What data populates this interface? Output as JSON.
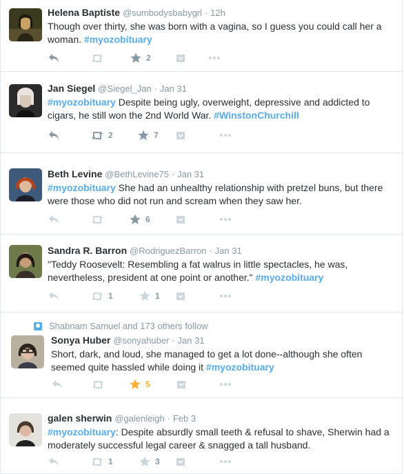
{
  "colors": {
    "link": "#55acee",
    "muted": "#8899a6",
    "fav_active": "#ffac33",
    "text": "#292f33"
  },
  "icons": [
    "reply-icon",
    "retweet-icon",
    "favorite-icon",
    "pocket-icon",
    "more-icon"
  ],
  "tweets": [
    {
      "name": "Helena Baptiste",
      "handle": "@sumbodysbabygrl",
      "time": "12h",
      "text_before": "Though over thirty, she was born with a vagina, so I guess you could call her a woman. ",
      "hashtag": "#myozobituary",
      "text_after": "",
      "retweets": "",
      "favorites": "2"
    },
    {
      "name": "Jan Siegel",
      "handle": "@Siegel_Jan",
      "time": "Jan 31",
      "hashtag": "#myozobituary",
      "text_after": " Despite being ugly, overweight, depressive and addicted to cigars, he still won the 2nd World War. ",
      "hashtag2": "#WinstonChurchill",
      "retweets": "2",
      "favorites": "7"
    },
    {
      "name": "Beth Levine",
      "handle": "@BethLevine75",
      "time": "Jan 31",
      "hashtag": "#myozobituary",
      "text_after": " She  had an unhealthy relationship with pretzel buns, but there were those who did not run and scream when they saw her.",
      "retweets": "",
      "favorites": "6"
    },
    {
      "name": "Sandra R. Barron",
      "handle": "@RodriguezBarron",
      "time": "Jan 31",
      "text_before": "\"Teddy Roosevelt: Resembling a fat walrus in little spectacles, he was, nevertheless, president at one point or another.\" ",
      "hashtag": "#myozobituary",
      "retweets": "1",
      "favorites": "1"
    },
    {
      "social_context": "Shabnam Samuel and 173 others follow",
      "name": "Sonya Huber",
      "handle": "@sonyahuber",
      "time": "Jan 31",
      "text_before": "Short, dark, and loud, she managed to get a lot done--although she often seemed quite hassled while doing it ",
      "hashtag": "#myozobituary",
      "retweets": "",
      "favorites": "5"
    },
    {
      "name": "galen sherwin",
      "handle": "@galenleigh",
      "time": "Feb 3",
      "hashtag": "#myozobituary",
      "text_after": ": Despite absurdly small teeth & refusal to shave, Sherwin had a moderately successful legal career & snagged a tall husband.",
      "retweets": "1",
      "favorites": "3"
    }
  ]
}
